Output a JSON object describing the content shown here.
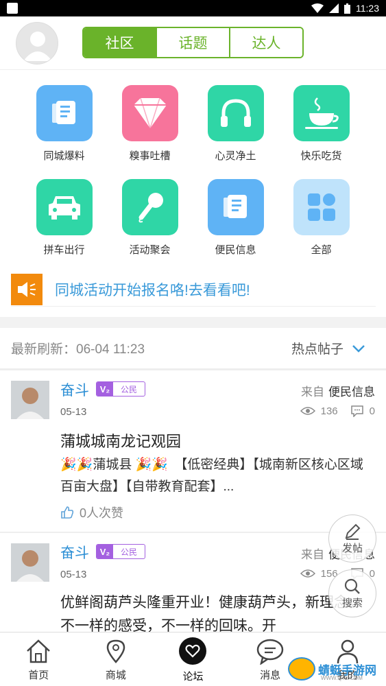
{
  "status_bar": {
    "time": "11:23"
  },
  "header": {
    "tabs": [
      {
        "label": "社区",
        "active": true
      },
      {
        "label": "话题",
        "active": false
      },
      {
        "label": "达人",
        "active": false
      }
    ]
  },
  "categories": [
    {
      "label": "同城爆料",
      "icon": "newspaper-icon",
      "color": "#5fb3f5"
    },
    {
      "label": "糗事吐槽",
      "icon": "diamond-icon",
      "color": "#f7749b"
    },
    {
      "label": "心灵净土",
      "icon": "headphones-icon",
      "color": "#2fd6a6"
    },
    {
      "label": "快乐吃货",
      "icon": "coffee-cup-icon",
      "color": "#2fd6a6"
    },
    {
      "label": "拼车出行",
      "icon": "car-icon",
      "color": "#2fd6a6"
    },
    {
      "label": "活动聚会",
      "icon": "microphone-icon",
      "color": "#2fd6a6"
    },
    {
      "label": "便民信息",
      "icon": "document-icon",
      "color": "#5fb3f5"
    },
    {
      "label": "全部",
      "icon": "grid-icon",
      "color": "#bfe3fb"
    }
  ],
  "notice": {
    "text": "同城活动开始报名咯!去看看吧!"
  },
  "refresh": {
    "label": "最新刷新：06-04 11:23",
    "sort_label": "热点帖子"
  },
  "posts": [
    {
      "author": "奋斗",
      "level": "V₂",
      "role": "公民",
      "from_prefix": "来自",
      "from_board": "便民信息",
      "date": "05-13",
      "views": "136",
      "comments": "0",
      "title": "蒲城城南龙记观园",
      "excerpt": "🎉🎉蒲城县 🎉🎉　【低密经典】【城南新区核心区域百亩大盘】【自带教育配套】...",
      "likes": "0人次赞"
    },
    {
      "author": "奋斗",
      "level": "V₂",
      "role": "公民",
      "from_prefix": "来自",
      "from_board": "便民信息",
      "date": "05-13",
      "views": "156",
      "comments": "0",
      "title": "优鲜阁葫芦头隆重开业！健康葫芦头，新理念。不一样的感受，不一样的回味。开"
    }
  ],
  "fabs": {
    "post": "发帖",
    "search": "搜索"
  },
  "bottom_nav": [
    {
      "label": "首页",
      "icon": "home-icon",
      "active": false
    },
    {
      "label": "商城",
      "icon": "map-pin-icon",
      "active": false
    },
    {
      "label": "论坛",
      "icon": "heart-chat-icon",
      "active": true
    },
    {
      "label": "消息",
      "icon": "chat-bubble-icon",
      "active": false
    },
    {
      "label": "我的",
      "icon": "user-icon",
      "active": false
    }
  ],
  "watermark": {
    "name": "蜻蜓手游网",
    "url": "WWW.QT6.COM"
  }
}
